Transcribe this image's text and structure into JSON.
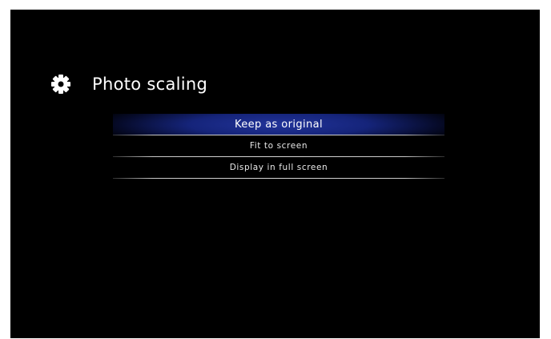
{
  "header": {
    "title": "Photo scaling",
    "icon": "gear-icon"
  },
  "menu": {
    "items": [
      {
        "label": "Keep as original",
        "selected": true
      },
      {
        "label": "Fit to screen",
        "selected": false
      },
      {
        "label": "Display in full screen",
        "selected": false
      }
    ]
  },
  "colors": {
    "background": "#000000",
    "selection": "#1b2a8a",
    "text": "#ffffff"
  }
}
